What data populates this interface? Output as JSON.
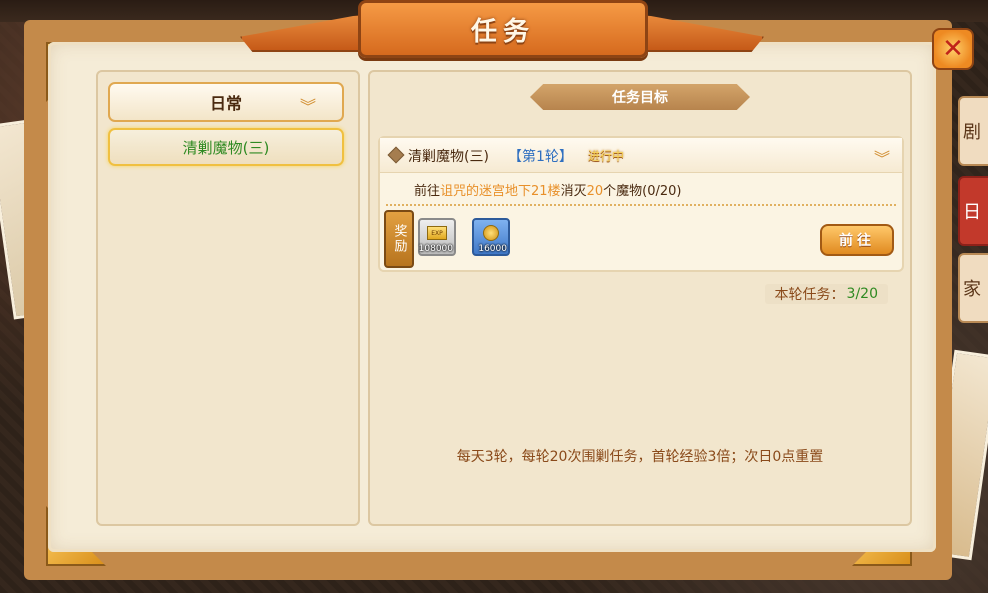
{
  "window": {
    "title": "任务"
  },
  "side_tabs": [
    "剧",
    "日",
    "家"
  ],
  "left_panel": {
    "category_dropdown": "日常",
    "tasks": [
      "清剿魔物(三)"
    ]
  },
  "right_panel": {
    "section_title": "任务目标",
    "task": {
      "name": "清剿魔物(三)",
      "round": "【第1轮】",
      "status": "进行中",
      "objective_prefix": "前往",
      "objective_location": "诅咒的迷宫地下21楼",
      "objective_mid": "消灭",
      "objective_count": "20",
      "objective_suffix": "个魔物(0/20)",
      "reward_label": "奖励",
      "rewards": [
        {
          "icon": "exp-scroll-icon",
          "quantity": "108000"
        },
        {
          "icon": "gold-coin-icon",
          "quantity": "16000"
        }
      ],
      "go_button": "前往"
    },
    "round_progress_label": "本轮任务：",
    "round_progress_value": "3/20",
    "footer_note": "每天3轮，每轮20次围剿任务，首轮经验3倍；次日0点重置"
  },
  "colors": {
    "accent_orange": "#d66a1e",
    "task_green": "#2f8a22",
    "highlight_orange": "#e8902a",
    "round_blue": "#2f6fc0"
  }
}
